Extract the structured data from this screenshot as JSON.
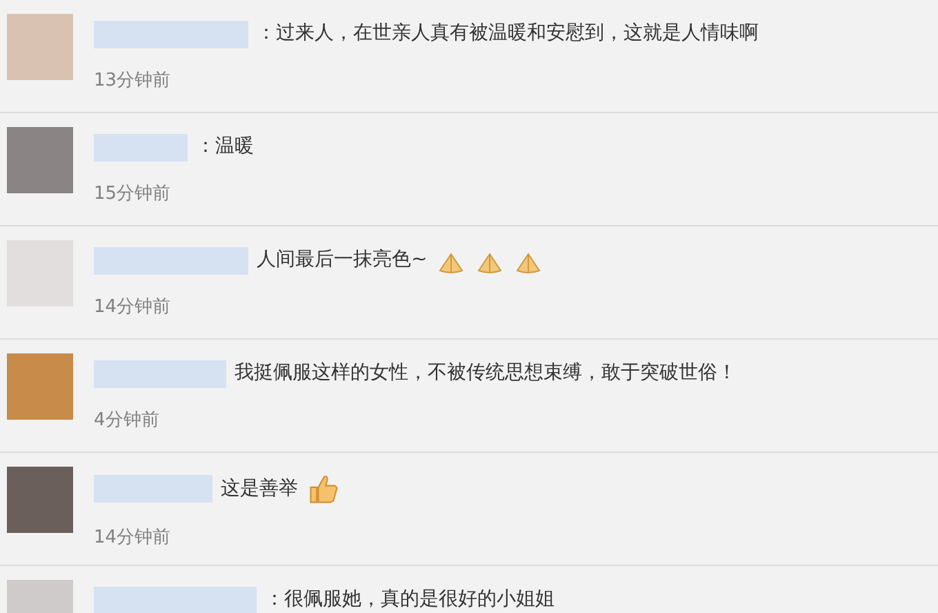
{
  "comments": [
    {
      "text": "：过来人，在世亲人真有被温暖和安慰到，这就是人情味啊",
      "time": "13分钟前"
    },
    {
      "text": "：温暖",
      "time": "15分钟前"
    },
    {
      "text": "人间最后一抹亮色~",
      "time": "14分钟前",
      "emojis": [
        {
          "kind": "hands"
        },
        {
          "kind": "hands"
        },
        {
          "kind": "hands"
        }
      ]
    },
    {
      "text": "我挺佩服这样的女性，不被传统思想束缚，敢于突破世俗！",
      "time": "4分钟前"
    },
    {
      "text": "这是善举",
      "time": "14分钟前",
      "emojis": [
        {
          "kind": "thumb"
        }
      ]
    },
    {
      "text": "：很佩服她，真的是很好的小姐姐"
    }
  ]
}
